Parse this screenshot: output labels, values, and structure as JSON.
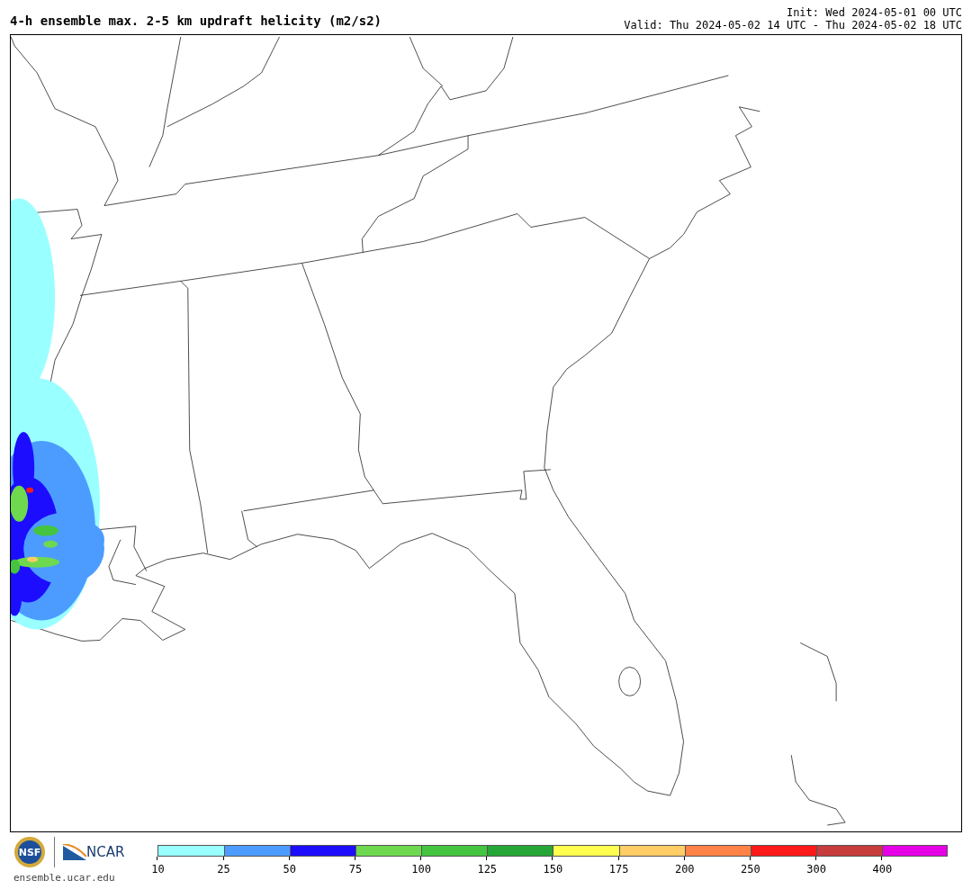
{
  "title": "4-h ensemble max. 2-5 km updraft helicity (m2/s2)",
  "init": "Init: Wed 2024-05-01 00 UTC",
  "valid": "Valid: Thu 2024-05-02 14 UTC - Thu 2024-05-02 18 UTC",
  "logos": {
    "nsf": "NSF",
    "ncar": "NCAR",
    "site": "ensemble.ucar.edu"
  },
  "colorbar": {
    "bins": [
      {
        "label": "10",
        "color": "#99ffff"
      },
      {
        "label": "25",
        "color": "#4c9cff"
      },
      {
        "label": "50",
        "color": "#1d0dff"
      },
      {
        "label": "75",
        "color": "#6ed94f"
      },
      {
        "label": "100",
        "color": "#44c43f"
      },
      {
        "label": "125",
        "color": "#26a637"
      },
      {
        "label": "150",
        "color": "#ffff4f"
      },
      {
        "label": "175",
        "color": "#ffcc66"
      },
      {
        "label": "200",
        "color": "#ff8247"
      },
      {
        "label": "250",
        "color": "#ff1a1a"
      },
      {
        "label": "300",
        "color": "#c73c3c"
      },
      {
        "label": "400",
        "color": "#e500e5"
      }
    ]
  }
}
